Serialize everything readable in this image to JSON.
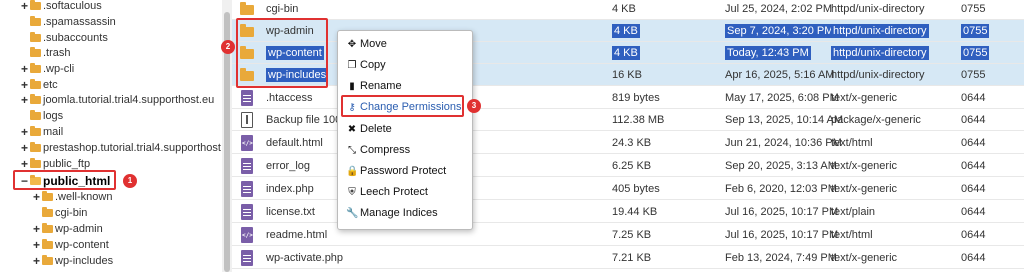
{
  "tree": {
    "items": [
      {
        "label": ".softaculous",
        "expander": "+"
      },
      {
        "label": ".spamassassin",
        "expander": ""
      },
      {
        "label": ".subaccounts",
        "expander": ""
      },
      {
        "label": ".trash",
        "expander": ""
      },
      {
        "label": ".wp-cli",
        "expander": "+"
      },
      {
        "label": "etc",
        "expander": "+"
      },
      {
        "label": "joomla.tutorial.trial4.supporthost.eu",
        "expander": "+"
      },
      {
        "label": "logs",
        "expander": ""
      },
      {
        "label": "mail",
        "expander": "+"
      },
      {
        "label": "prestashop.tutorial.trial4.supporthost",
        "expander": "+"
      },
      {
        "label": "public_ftp",
        "expander": "+"
      },
      {
        "label": "public_html",
        "expander": "−"
      },
      {
        "label": ".well-known",
        "expander": "+"
      },
      {
        "label": "cgi-bin",
        "expander": ""
      },
      {
        "label": "wp-admin",
        "expander": "+"
      },
      {
        "label": "wp-content",
        "expander": "+"
      },
      {
        "label": "wp-includes",
        "expander": "+"
      }
    ]
  },
  "files": [
    {
      "name": "cgi-bin",
      "size": "4 KB",
      "date": "Jul 25, 2024, 2:02 PM",
      "type": "httpd/unix-directory",
      "perm": "0755",
      "icon": "folder-icon"
    },
    {
      "name": "wp-admin",
      "size": "4 KB",
      "date": "Sep 7, 2024, 3:20 PM",
      "type": "httpd/unix-directory",
      "perm": "0755",
      "icon": "folder-icon"
    },
    {
      "name": "wp-content",
      "size": "4 KB",
      "date": "Today, 12:43 PM",
      "type": "httpd/unix-directory",
      "perm": "0755",
      "icon": "folder-icon"
    },
    {
      "name": "wp-includes",
      "size": "16 KB",
      "date": "Apr 16, 2025, 5:16 AM",
      "type": "httpd/unix-directory",
      "perm": "0755",
      "icon": "folder-icon"
    },
    {
      "name": ".htaccess",
      "size": "819 bytes",
      "date": "May 17, 2025, 6:08 PM",
      "type": "text/x-generic",
      "perm": "0644",
      "icon": "document-icon"
    },
    {
      "name": "Backup file 100",
      "size": "112.38 MB",
      "date": "Sep 13, 2025, 10:14 AM",
      "type": "package/x-generic",
      "perm": "0644",
      "icon": "archive-icon"
    },
    {
      "name": "default.html",
      "size": "24.3 KB",
      "date": "Jun 21, 2024, 10:36 PM",
      "type": "text/html",
      "perm": "0644",
      "icon": "code-file-icon"
    },
    {
      "name": "error_log",
      "size": "6.25 KB",
      "date": "Sep 20, 2025, 3:13 AM",
      "type": "text/x-generic",
      "perm": "0644",
      "icon": "document-icon"
    },
    {
      "name": "index.php",
      "size": "405 bytes",
      "date": "Feb 6, 2020, 12:03 PM",
      "type": "text/x-generic",
      "perm": "0644",
      "icon": "document-icon"
    },
    {
      "name": "license.txt",
      "size": "19.44 KB",
      "date": "Jul 16, 2025, 10:17 PM",
      "type": "text/plain",
      "perm": "0644",
      "icon": "document-icon"
    },
    {
      "name": "readme.html",
      "size": "7.25 KB",
      "date": "Jul 16, 2025, 10:17 PM",
      "type": "text/html",
      "perm": "0644",
      "icon": "code-file-icon"
    },
    {
      "name": "wp-activate.php",
      "size": "7.21 KB",
      "date": "Feb 13, 2024, 7:49 PM",
      "type": "text/x-generic",
      "perm": "0644",
      "icon": "document-icon"
    }
  ],
  "context_menu": {
    "items": [
      {
        "label": "Move",
        "icon": "move-icon",
        "glyph": "✥"
      },
      {
        "label": "Copy",
        "icon": "copy-icon",
        "glyph": "❐"
      },
      {
        "label": "Rename",
        "icon": "rename-icon",
        "glyph": "▮"
      },
      {
        "label": "Change Permissions",
        "icon": "key-icon",
        "glyph": "⚷"
      },
      {
        "label": "Delete",
        "icon": "delete-icon",
        "glyph": "✖"
      },
      {
        "label": "Compress",
        "icon": "compress-icon",
        "glyph": "⤡"
      },
      {
        "label": "Password Protect",
        "icon": "lock-icon",
        "glyph": "🔒"
      },
      {
        "label": "Leech Protect",
        "icon": "shield-icon",
        "glyph": "⛨"
      },
      {
        "label": "Manage Indices",
        "icon": "wrench-icon",
        "glyph": "🔧"
      }
    ]
  },
  "badges": {
    "one": "1",
    "two": "2",
    "three": "3"
  },
  "colors": {
    "selection": "#d6e8f5",
    "highlight": "#2f5fbf",
    "annotation": "#e03131",
    "folder": "#e9a93a"
  }
}
